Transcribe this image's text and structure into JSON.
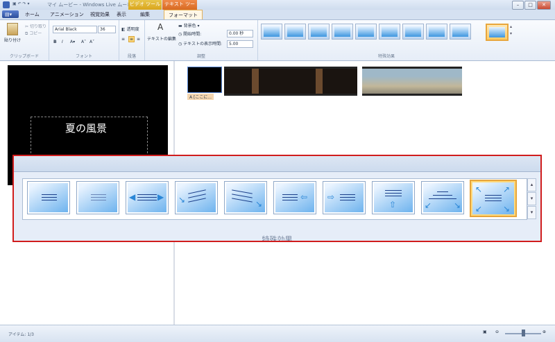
{
  "window": {
    "title": "マイ ムービー - Windows Live ムービー メーカー",
    "context_video": "ビデオ ツール",
    "context_text": "テキスト ツール"
  },
  "tabs": [
    "ホーム",
    "アニメーション",
    "視覚効果",
    "表示",
    "編集",
    "フォーマット"
  ],
  "ribbon": {
    "clipboard": {
      "paste": "貼り付け",
      "cut": "切り取り",
      "copy": "コピー",
      "label": "クリップボード"
    },
    "font": {
      "family": "Arial Black",
      "size": "36",
      "bold": "B",
      "italic": "I",
      "label": "フォント"
    },
    "paragraph": {
      "transparency": "透明度",
      "label": "段落"
    },
    "adjust": {
      "edit_text": "テキストの編集",
      "bgcolor": "背景色",
      "start_time_label": "開始時間:",
      "start_time_value": "0.00 秒",
      "duration_label": "テキストの表示時間:",
      "duration_value": "5.00",
      "label": "調整"
    },
    "effects": {
      "label": "特殊効果"
    }
  },
  "preview": {
    "caption": "夏の風景"
  },
  "storyboard": {
    "clip1_caption": "[ここに..."
  },
  "status": {
    "items": "アイテム: 1/3"
  },
  "zoom": {
    "label": "特殊効果"
  }
}
